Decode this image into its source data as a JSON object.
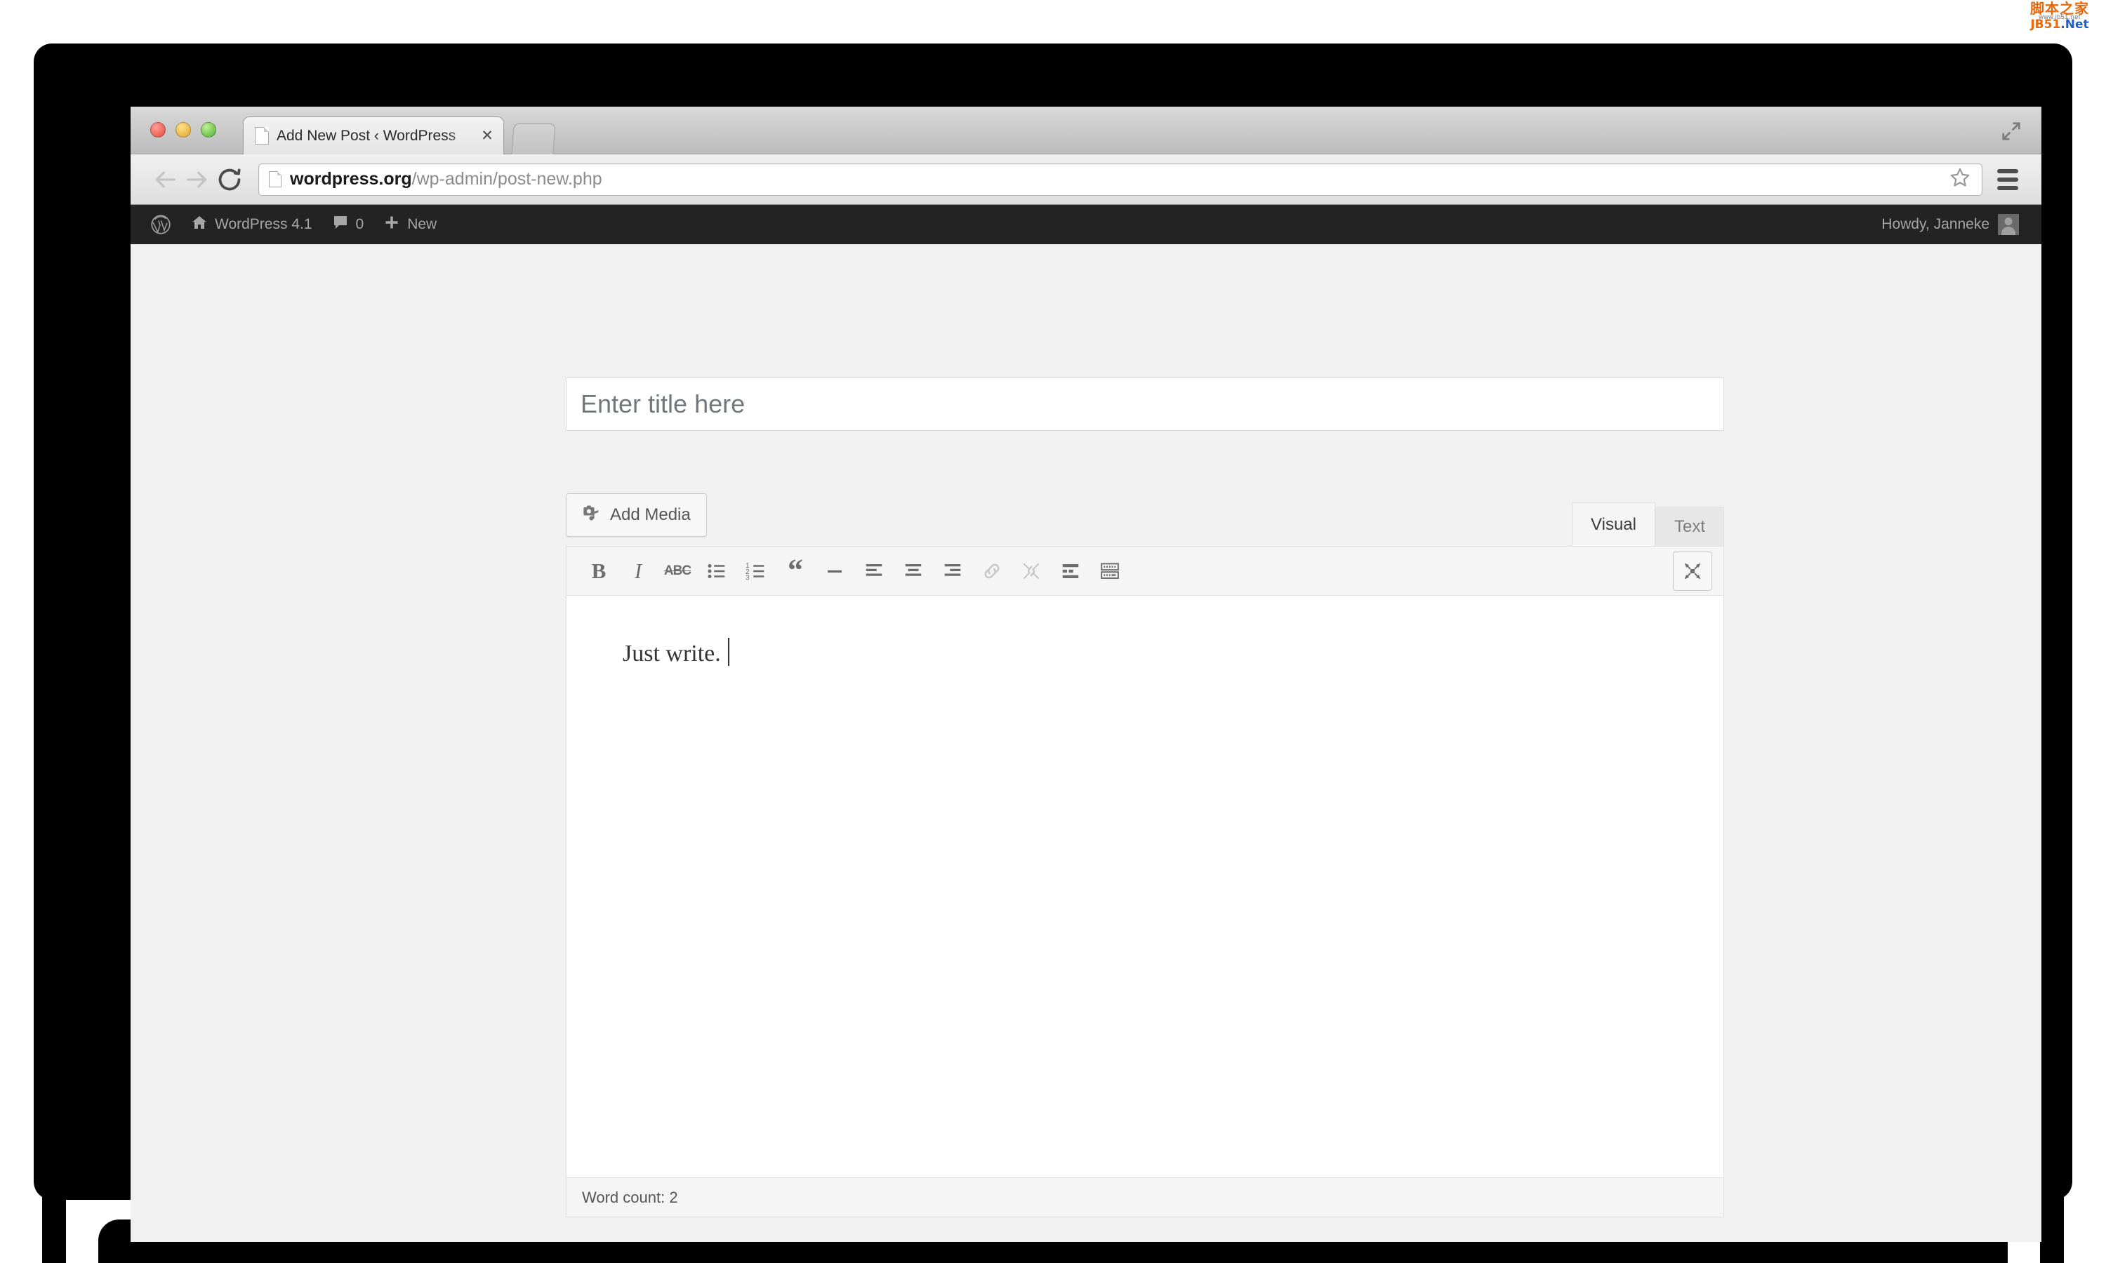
{
  "watermark": {
    "chinese": "脚本之家",
    "sub": "www.jb51.net",
    "jb": "JB51",
    "net": ".Net"
  },
  "browser": {
    "traffic_lights": [
      "close-red",
      "minimize-yellow",
      "maximize-green"
    ],
    "tab": {
      "title": "Add New Post ‹ WordPress",
      "close_label": "✕",
      "favicon": "page-icon"
    },
    "newtab_label": "",
    "expand_icon": "expand-window-icon",
    "nav": {
      "back_icon": "back-arrow-icon",
      "forward_icon": "forward-arrow-icon",
      "reload_icon": "reload-icon"
    },
    "omnibox": {
      "host": "wordpress.org",
      "path": "/wp-admin/post-new.php",
      "favicon": "page-icon",
      "star_icon": "bookmark-star-icon"
    },
    "menu_icon": "hamburger-menu-icon"
  },
  "adminbar": {
    "logo": "wordpress-logo-icon",
    "site_icon": "home-icon",
    "site_name": "WordPress 4.1",
    "comments_icon": "comment-bubble-icon",
    "comments_count": "0",
    "new_icon": "plus-icon",
    "new_label": "New",
    "howdy": "Howdy, Janneke",
    "avatar": "user-avatar"
  },
  "editor": {
    "title_placeholder": "Enter title here",
    "add_media_label": "Add Media",
    "add_media_icon": "add-media-icon",
    "tabs": [
      {
        "label": "Visual",
        "active": true
      },
      {
        "label": "Text",
        "active": false
      }
    ],
    "toolbar": [
      {
        "name": "bold",
        "label": "B"
      },
      {
        "name": "italic",
        "label": "I"
      },
      {
        "name": "strikethrough",
        "label": "ABC"
      },
      {
        "name": "bullet-list",
        "label": ""
      },
      {
        "name": "numbered-list",
        "label": ""
      },
      {
        "name": "blockquote",
        "label": "“"
      },
      {
        "name": "horizontal-rule",
        "label": ""
      },
      {
        "name": "align-left",
        "label": ""
      },
      {
        "name": "align-center",
        "label": ""
      },
      {
        "name": "align-right",
        "label": ""
      },
      {
        "name": "insert-link",
        "label": ""
      },
      {
        "name": "remove-link",
        "label": ""
      },
      {
        "name": "insert-more-tag",
        "label": ""
      },
      {
        "name": "keyboard-shortcuts",
        "label": ""
      }
    ],
    "fullscreen_icon": "distraction-free-icon",
    "content": "Just write.",
    "word_count": "Word count: 2"
  },
  "colors": {
    "adminbar_bg": "#232323",
    "page_bg": "#f1f1f1",
    "editor_bg": "#ffffff",
    "toolbar_bg": "#f5f5f5",
    "bezel": "#000000"
  }
}
